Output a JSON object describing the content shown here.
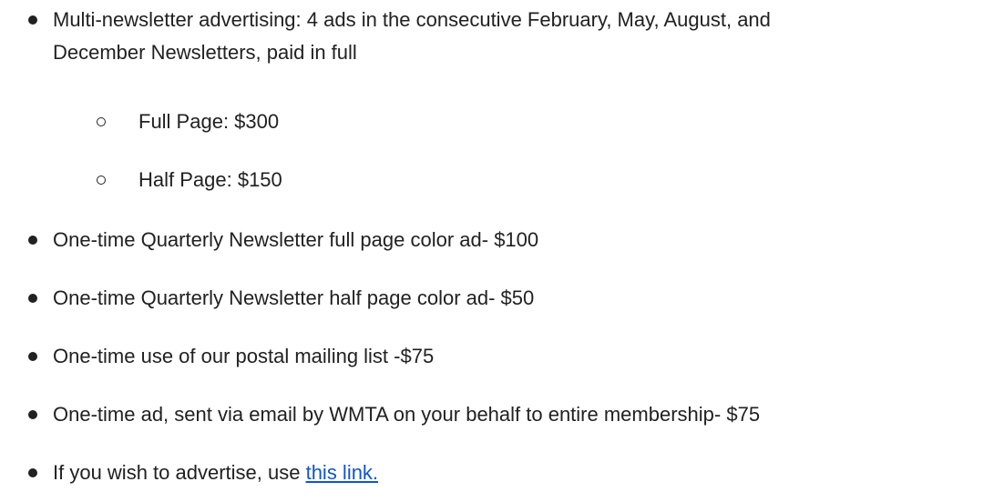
{
  "list": {
    "item1": {
      "line1": "Multi-newsletter advertising: 4 ads in the consecutive February, May, August, and",
      "line2": "December Newsletters, paid in full"
    },
    "sub_items": [
      "Full Page: $300",
      "Half Page: $150"
    ],
    "items": [
      "One-time Quarterly Newsletter full page color ad- $100",
      "One-time Quarterly Newsletter half page color ad- $50",
      "One-time use of our postal mailing list -$75",
      "One-time ad, sent via email by WMTA on your behalf to entire membership- $75"
    ],
    "last_item": {
      "prefix": "If you wish to advertise, use ",
      "link_text": "this link."
    }
  },
  "colors": {
    "text": "#212121",
    "link": "#1155cc",
    "background": "#ffffff"
  },
  "icons": {
    "bullet": "filled-circle-bullet-icon",
    "sub_bullet": "hollow-circle-bullet-icon"
  }
}
